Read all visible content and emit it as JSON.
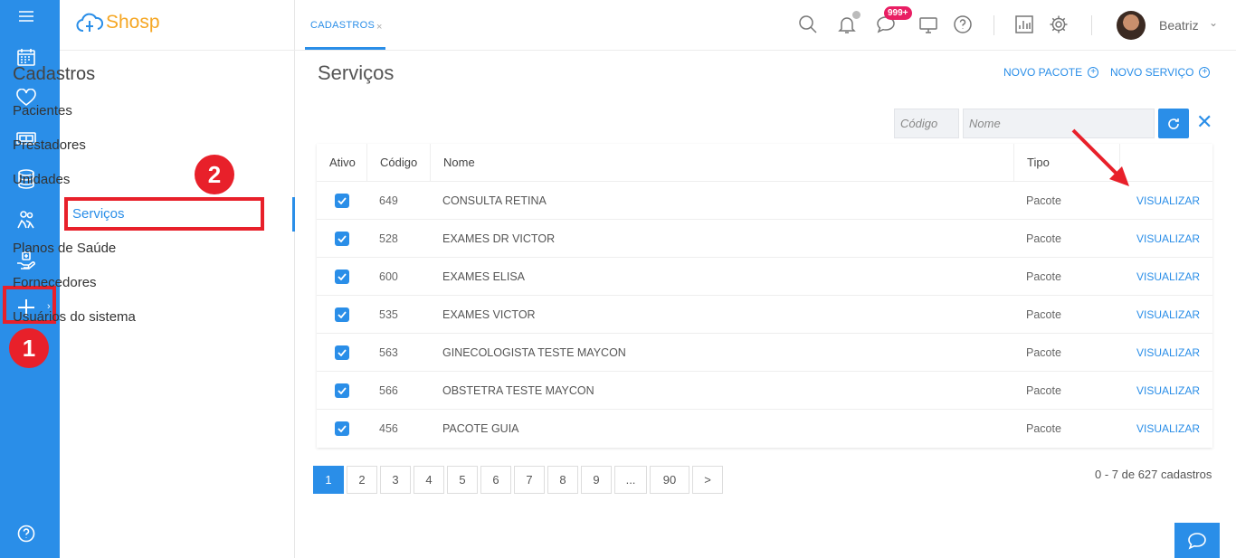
{
  "app": {
    "brand": "Shosp",
    "accent": "#2a8ee8",
    "highlight_color": "#e8202a"
  },
  "rail": {
    "items": [
      "menu-icon",
      "calendar-icon",
      "heart-icon",
      "money-icon",
      "database-icon",
      "people-icon",
      "hand-care-icon",
      "plus-icon",
      "help-icon"
    ]
  },
  "left_panel": {
    "title": "Cadastros",
    "items": [
      "Pacientes",
      "Prestadores",
      "Unidades",
      "Serviços",
      "Planos de Saúde",
      "Fornecedores",
      "Usuários do sistema"
    ],
    "active_item": "Serviços"
  },
  "annotations": {
    "step1": "1",
    "step2": "2"
  },
  "topbar": {
    "tab": "CADASTROS",
    "tab_close": "×",
    "messages_badge": "999+",
    "user_name": "Beatriz",
    "user_chevron": "⌄"
  },
  "main": {
    "title": "Serviços",
    "new_package": "NOVO PACOTE",
    "new_service": "NOVO SERVIÇO",
    "filter_code_placeholder": "Código",
    "filter_name_placeholder": "Nome",
    "close_filter": "✕"
  },
  "table": {
    "headers": [
      "Ativo",
      "Código",
      "Nome",
      "Tipo",
      ""
    ],
    "rows": [
      {
        "active": true,
        "code": "649",
        "name": "CONSULTA RETINA",
        "type": "Pacote",
        "action": "VISUALIZAR"
      },
      {
        "active": true,
        "code": "528",
        "name": "EXAMES DR VICTOR",
        "type": "Pacote",
        "action": "VISUALIZAR"
      },
      {
        "active": true,
        "code": "600",
        "name": "EXAMES ELISA",
        "type": "Pacote",
        "action": "VISUALIZAR"
      },
      {
        "active": true,
        "code": "535",
        "name": "EXAMES VICTOR",
        "type": "Pacote",
        "action": "VISUALIZAR"
      },
      {
        "active": true,
        "code": "563",
        "name": "GINECOLOGISTA TESTE MAYCON",
        "type": "Pacote",
        "action": "VISUALIZAR"
      },
      {
        "active": true,
        "code": "566",
        "name": "OBSTETRA TESTE MAYCON",
        "type": "Pacote",
        "action": "VISUALIZAR"
      },
      {
        "active": true,
        "code": "456",
        "name": "PACOTE GUIA",
        "type": "Pacote",
        "action": "VISUALIZAR"
      }
    ]
  },
  "pagination": {
    "pages": [
      "1",
      "2",
      "3",
      "4",
      "5",
      "6",
      "7",
      "8",
      "9",
      "...",
      "90",
      ">"
    ],
    "current": "1",
    "summary": "0 - 7 de 627 cadastros"
  }
}
